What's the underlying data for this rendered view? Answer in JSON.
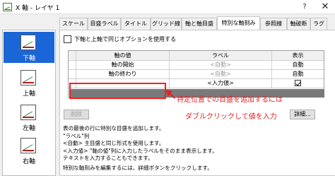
{
  "window": {
    "title": "X 軸 - レイヤ 1",
    "help_label": "?",
    "close_label": "✕"
  },
  "tabs": [
    {
      "label": "スケール"
    },
    {
      "label": "目盛ラベル"
    },
    {
      "label": "タイトル"
    },
    {
      "label": "グリッド線"
    },
    {
      "label": "軸と軸目盛"
    },
    {
      "label": "特別な軸刻み",
      "active": true
    },
    {
      "label": "参照線"
    },
    {
      "label": "軸破断"
    },
    {
      "label": "ラグ"
    }
  ],
  "sidebar": {
    "items": [
      {
        "label": "下軸",
        "icon": "axis-bottom-icon",
        "selected": true
      },
      {
        "label": "上軸",
        "icon": "axis-top-icon"
      },
      {
        "label": "左軸",
        "icon": "axis-left-icon"
      },
      {
        "label": "右軸",
        "icon": "axis-right-icon"
      }
    ]
  },
  "panel": {
    "checkbox_label": "下軸と上軸で同じオプションを使用する",
    "checkbox_checked": false,
    "grid": {
      "headers": [
        "軸の値",
        "ラベル",
        "表示"
      ],
      "rows": [
        {
          "axis_value": "軸の開始",
          "label": "<自動>",
          "display": "自動"
        },
        {
          "axis_value": "軸の終わり",
          "label": "<自動>",
          "display": "自動"
        },
        {
          "axis_value": "",
          "label": "<入力値>",
          "display_checked": true
        }
      ]
    },
    "delete_button": "削除",
    "detail_button": "詳細...",
    "description_lines": [
      "表の最後の行に特別な目盛を追加します。",
      "\"ラベル\"列",
      "<自動> 主目盛と同じ形式を使用します。",
      "<入力値> \"軸の値\"列に入力したラベルをそのまま表示します。",
      "テキストを入力することもできます。"
    ],
    "footer_text": "特別な軸刻みを編集するには、詳細ボタンをクリックします。"
  },
  "annotation": {
    "line1": "特定位置での目盛を追加するには",
    "line2": "ダブルクリックして値を入力",
    "color": "#e52020"
  }
}
